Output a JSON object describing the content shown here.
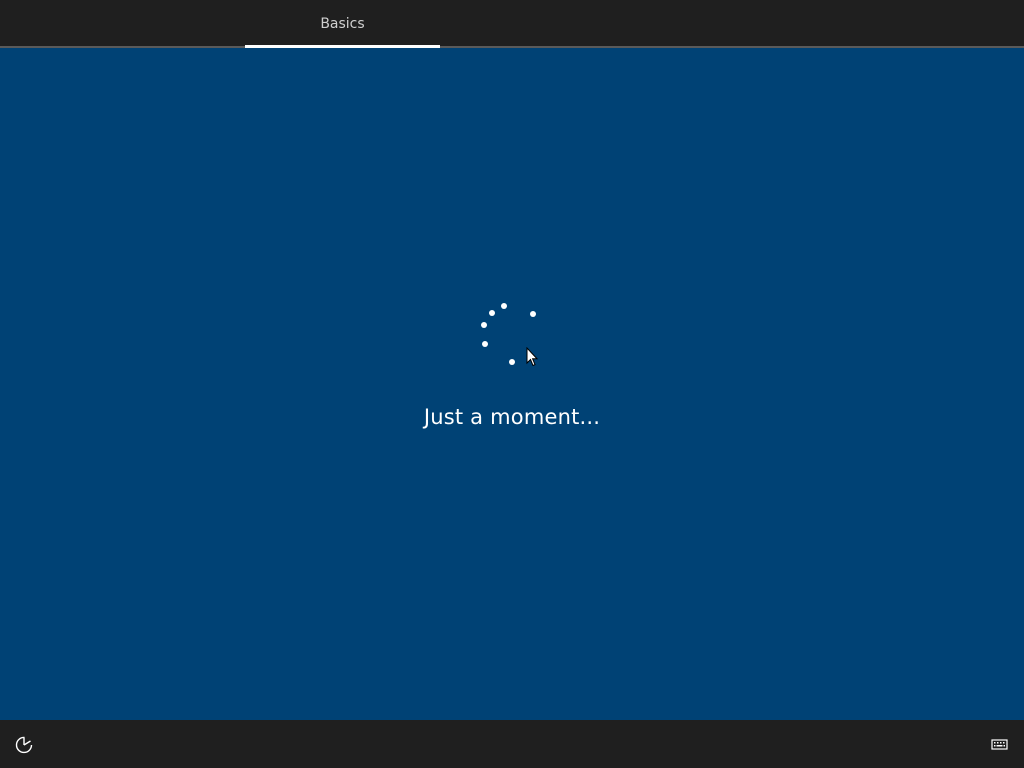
{
  "header": {
    "tabs": [
      {
        "label": "Basics",
        "active": true
      }
    ]
  },
  "main": {
    "status_text": "Just a moment...",
    "spinner_icon": "loading-dots-icon"
  },
  "footer": {
    "left_icon": "ease-of-access-icon",
    "right_icon": "keyboard-icon"
  },
  "colors": {
    "background": "#004275",
    "bars": "#1f1f1f",
    "accent": "#ffffff"
  }
}
